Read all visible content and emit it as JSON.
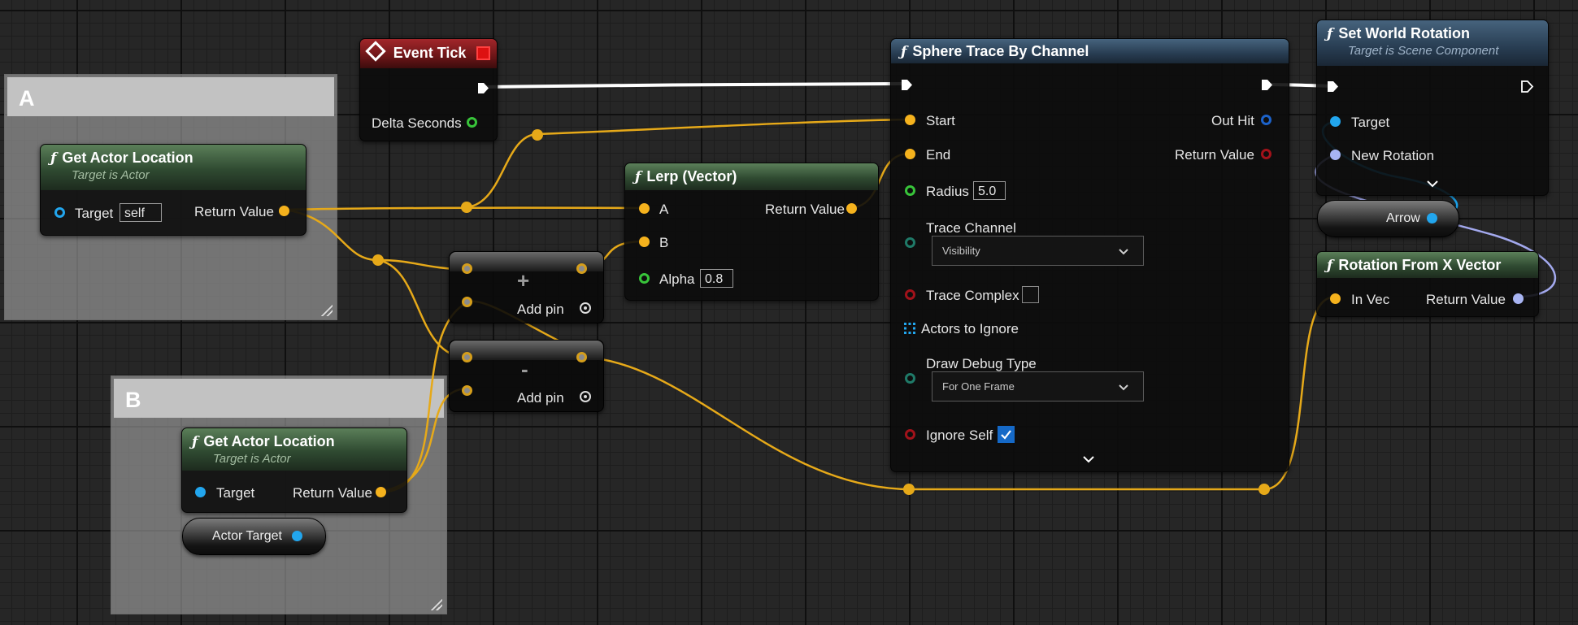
{
  "comments": {
    "a_title": "A",
    "b_title": "B"
  },
  "event_tick": {
    "title": "Event Tick",
    "delta_label": "Delta Seconds"
  },
  "get_actor_location_a": {
    "title": "Get Actor Location",
    "subtitle": "Target is Actor",
    "target_label": "Target",
    "target_value": "self",
    "return_label": "Return Value"
  },
  "get_actor_location_b": {
    "title": "Get Actor Location",
    "subtitle": "Target is Actor",
    "target_label": "Target",
    "return_label": "Return Value"
  },
  "actor_target": {
    "label": "Actor Target"
  },
  "add_node": {
    "op": "+",
    "add_pin": "Add pin"
  },
  "subtract_node": {
    "op": "-",
    "add_pin": "Add pin"
  },
  "lerp": {
    "title": "Lerp (Vector)",
    "a_label": "A",
    "b_label": "B",
    "alpha_label": "Alpha",
    "alpha_value": "0.8",
    "return_label": "Return Value"
  },
  "sphere_trace": {
    "title": "Sphere Trace By Channel",
    "start_label": "Start",
    "end_label": "End",
    "radius_label": "Radius",
    "radius_value": "5.0",
    "trace_channel_label": "Trace Channel",
    "trace_channel_value": "Visibility",
    "trace_complex_label": "Trace Complex",
    "actors_ignore_label": "Actors to Ignore",
    "draw_debug_label": "Draw Debug Type",
    "draw_debug_value": "For One Frame",
    "ignore_self_label": "Ignore Self",
    "out_hit_label": "Out Hit",
    "return_label": "Return Value"
  },
  "set_world_rotation": {
    "title": "Set World Rotation",
    "subtitle": "Target is Scene Component",
    "target_label": "Target",
    "new_rotation_label": "New Rotation"
  },
  "arrow": {
    "label": "Arrow"
  },
  "rotation_from_x": {
    "title": "Rotation From X Vector",
    "in_label": "In Vec",
    "return_label": "Return Value"
  },
  "glyphs": {
    "fn": "ƒ",
    "chevron": "⌄"
  },
  "colors": {
    "vector_wire": "#e6a919",
    "exec_wire": "#ffffff",
    "object_wire": "#1ba3ec",
    "rotator_wire": "#a3a9ee",
    "event_header": "#a2262a",
    "pure_header": "#4f7450",
    "callable_header": "#3d5a77"
  },
  "icons": [
    "event-diamond-icon",
    "function-icon",
    "exec-pin-icon",
    "add-pin-icon",
    "chevron-down-icon",
    "array-pin-icon",
    "checkmark-icon",
    "resize-grip-icon"
  ]
}
